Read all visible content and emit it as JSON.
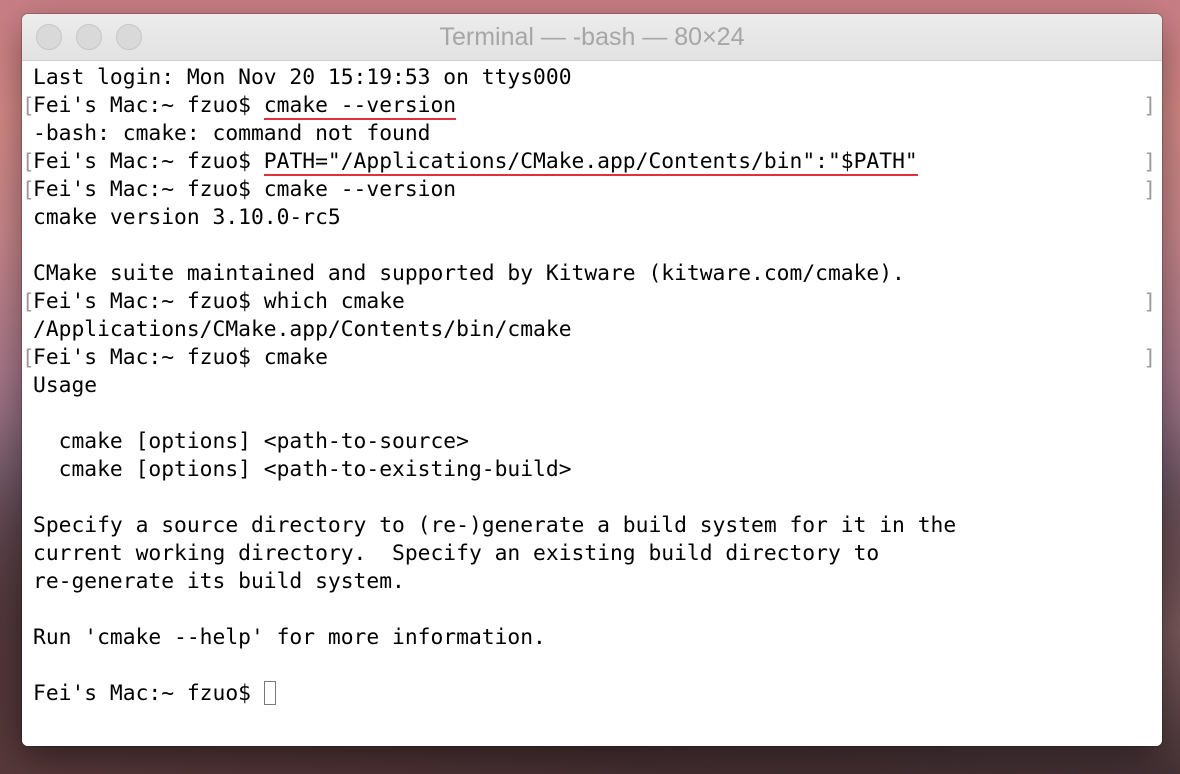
{
  "window": {
    "title": "Terminal — -bash — 80×24"
  },
  "terminal": {
    "lines": [
      "Last login: Mon Nov 20 15:19:53 on ttys000",
      {
        "prompt": "Fei's Mac:~ fzuo$ ",
        "command": "cmake --version"
      },
      "-bash: cmake: command not found",
      {
        "prompt": "Fei's Mac:~ fzuo$ ",
        "command": "PATH=\"/Applications/CMake.app/Contents/bin\":\"$PATH\""
      },
      {
        "prompt": "Fei's Mac:~ fzuo$ ",
        "command": "cmake --version"
      },
      "cmake version 3.10.0-rc5",
      "",
      "CMake suite maintained and supported by Kitware (kitware.com/cmake).",
      {
        "prompt": "Fei's Mac:~ fzuo$ ",
        "command": "which cmake"
      },
      "/Applications/CMake.app/Contents/bin/cmake",
      {
        "prompt": "Fei's Mac:~ fzuo$ ",
        "command": "cmake"
      },
      "Usage",
      "",
      "  cmake [options] <path-to-source>",
      "  cmake [options] <path-to-existing-build>",
      "",
      "Specify a source directory to (re-)generate a build system for it in the",
      "current working directory.  Specify an existing build directory to",
      "re-generate its build system.",
      "",
      "Run 'cmake --help' for more information.",
      "",
      "Fei's Mac:~ fzuo$ "
    ],
    "mark_open": "[",
    "mark_close": "]"
  },
  "colors": {
    "annotation_underline": "#e0303a",
    "text": "#000000",
    "title_text": "#a6a6a6"
  }
}
